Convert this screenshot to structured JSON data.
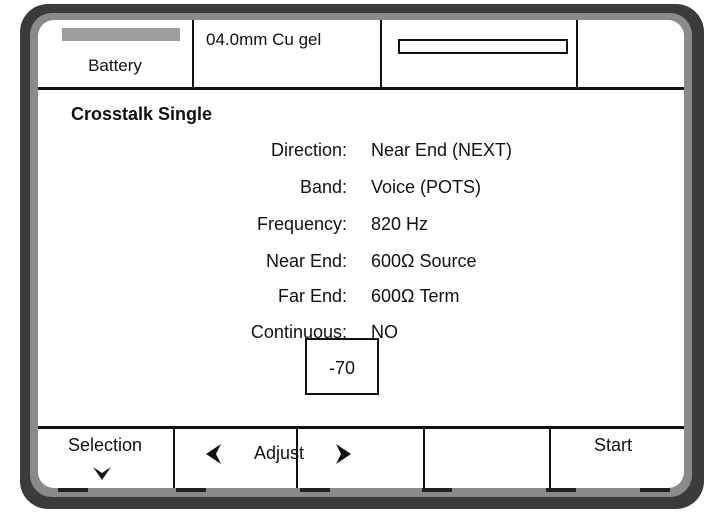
{
  "status_bar": {
    "battery_label": "Battery",
    "cable_label": "04.0mm Cu gel"
  },
  "test": {
    "title": "Crosstalk Single",
    "params": [
      {
        "label": "Direction:",
        "value": "Near End (NEXT)"
      },
      {
        "label": "Band:",
        "value": "Voice (POTS)"
      },
      {
        "label": "Frequency:",
        "value": "820 Hz"
      },
      {
        "label": "Near End:",
        "value": "600Ω Source"
      },
      {
        "label": "Far End:",
        "value": "600Ω Term"
      },
      {
        "label": "Continuous:",
        "value": "NO"
      }
    ],
    "selected_value": "-70"
  },
  "softkeys": {
    "selection": "Selection",
    "adjust": "Adjust",
    "start": "Start"
  },
  "icons": {
    "selection": "chevron-down-icon",
    "adjust_left": "arrow-left-icon",
    "adjust_right": "arrow-right-icon"
  },
  "colors": {
    "bezel": "#3a3a3a",
    "screen": "#ffffff",
    "text": "#111111",
    "battery_fill": "#9e9e9e"
  }
}
